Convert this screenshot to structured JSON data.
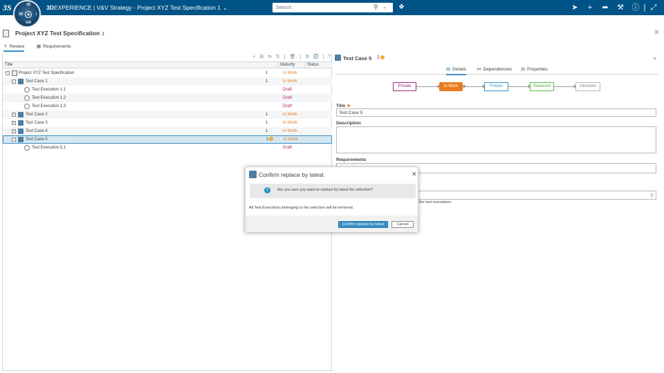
{
  "topbar": {
    "brand_bold": "3D",
    "brand_rest": "EXPERIENCE",
    "separator": " | ",
    "app_name": "V&V Strategy - Project XYZ Test Specification 1",
    "compass": {
      "top_label": "3D",
      "right_label": "i",
      "bottom_label": "V,R"
    },
    "search": {
      "placeholder": "Search"
    },
    "icons": [
      "share-icon",
      "add-icon",
      "forward-icon",
      "tools-icon",
      "help-icon",
      "expand-icon"
    ],
    "accent_color": "#005386"
  },
  "page": {
    "title": "Project XYZ Test Specification",
    "count": "1",
    "tabs": [
      {
        "label": "Review",
        "active": true
      },
      {
        "label": "Requirements",
        "active": false
      }
    ]
  },
  "tree": {
    "columns": {
      "title": "Title",
      "maturity": "Maturity",
      "status": "Status"
    },
    "rows": [
      {
        "label": "Project XYZ Test Specification",
        "count": "1",
        "maturity": "In Work",
        "kind": "spec"
      },
      {
        "label": "Test Case 1",
        "count": "1",
        "maturity": "In Work",
        "kind": "case"
      },
      {
        "label": "Test Execution 1.1",
        "count": "",
        "maturity": "Draft",
        "kind": "exec"
      },
      {
        "label": "Test Execution 1.2",
        "count": "",
        "maturity": "Draft",
        "kind": "exec"
      },
      {
        "label": "Test Execution 1.3",
        "count": "",
        "maturity": "Draft",
        "kind": "exec"
      },
      {
        "label": "Test Case 2",
        "count": "1",
        "maturity": "In Work",
        "kind": "case"
      },
      {
        "label": "Test Case 3",
        "count": "1",
        "maturity": "In Work",
        "kind": "case"
      },
      {
        "label": "Test Case 4",
        "count": "1",
        "maturity": "In Work",
        "kind": "case"
      },
      {
        "label": "Test Case 5",
        "count": "1",
        "maturity": "In Work",
        "kind": "case"
      },
      {
        "label": "Test Execution 5.1",
        "count": "",
        "maturity": "Draft",
        "kind": "exec"
      }
    ]
  },
  "details": {
    "title": "Test Case 5",
    "revision": "1",
    "tabs": [
      {
        "label": "Details",
        "active": true
      },
      {
        "label": "Dependencies",
        "active": false
      },
      {
        "label": "Properties",
        "active": false
      }
    ],
    "lifecycle": [
      {
        "label": "Private",
        "color": "#a3237a"
      },
      {
        "label": "In Work",
        "color": "#e87b1e"
      },
      {
        "label": "Frozen",
        "color": "#368ec4"
      },
      {
        "label": "Released",
        "color": "#57b847"
      },
      {
        "label": "Obsolete",
        "color": "#8a8a8a"
      }
    ],
    "fields": {
      "title_label": "Title",
      "title_value": "Test Case 5",
      "description_label": "Description",
      "description_value": "",
      "requirements_label": "Requirements",
      "requirements_value": "",
      "partial_note": "the test executions."
    }
  },
  "modal": {
    "title": "Confirm replace by latest",
    "question": "Are you sure you want to replace by latest the selection?",
    "note": "All Test Executions belonging to the selection will be removed.",
    "confirm_label": "Confirm replace by latest",
    "cancel_label": "Cancel"
  }
}
